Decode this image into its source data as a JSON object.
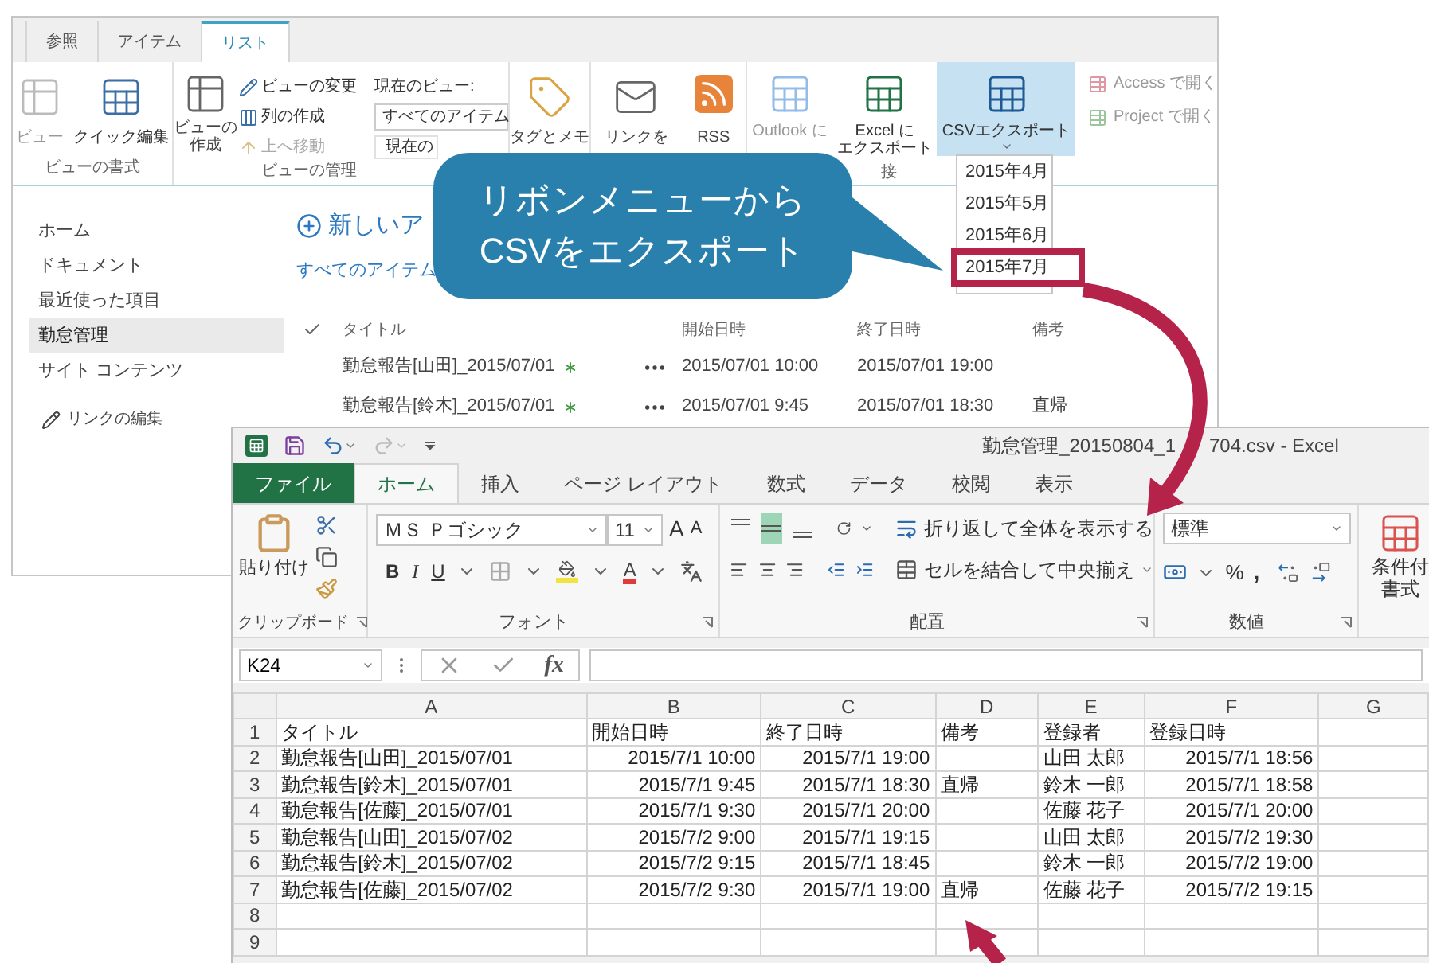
{
  "sharepoint": {
    "tabs": [
      {
        "label": "参照",
        "selected": false
      },
      {
        "label": "アイテム",
        "selected": false
      },
      {
        "label": "リスト",
        "selected": true
      }
    ],
    "ribbon": {
      "view_format": {
        "label": "ビューの書式",
        "buttons": [
          {
            "kind": "view",
            "label": "ビュー",
            "disabled": true
          },
          {
            "kind": "quick_edit",
            "label": "クイック編集",
            "disabled": false
          }
        ]
      },
      "view_manage": {
        "label": "ビューの管理",
        "create_view": [
          "ビューの",
          "作成"
        ],
        "commands": [
          {
            "kind": "modify",
            "label": "ビューの変更",
            "disabled": false
          },
          {
            "kind": "column",
            "label": "列の作成",
            "disabled": false
          },
          {
            "kind": "up",
            "label": "上へ移動",
            "disabled": true
          }
        ],
        "current_view_label": "現在のビュー:",
        "current_view": "すべてのアイテム",
        "view_nav": "現在の"
      },
      "tags": "タグとメモ",
      "share": [
        "リンクを",
        "RSS"
      ],
      "connect": {
        "label": "接",
        "buttons": [
          {
            "kind": "outlook",
            "label": [
              "Outlook に"
            ],
            "disabled": true,
            "selected": false
          },
          {
            "kind": "excel",
            "label": [
              "Excel に",
              "エクスポート"
            ],
            "disabled": false,
            "selected": false
          },
          {
            "kind": "csv",
            "label": [
              "CSVエクスポート"
            ],
            "disabled": false,
            "selected": true
          }
        ],
        "open_with": [
          {
            "kind": "access",
            "label": "Access で開く",
            "disabled": true
          },
          {
            "kind": "project",
            "label": "Project で開く",
            "disabled": true
          }
        ]
      }
    },
    "csv_menu": [
      {
        "label": "2015年4月",
        "framed": false
      },
      {
        "label": "2015年5月",
        "framed": false
      },
      {
        "label": "2015年6月",
        "framed": false
      },
      {
        "label": "2015年7月",
        "framed": true
      }
    ],
    "nav": [
      {
        "label": "ホーム",
        "selected": false
      },
      {
        "label": "ドキュメント",
        "selected": false
      },
      {
        "label": "最近使った項目",
        "selected": false
      },
      {
        "label": "勤怠管理",
        "selected": true
      },
      {
        "label": "サイト コンテンツ",
        "selected": false
      }
    ],
    "edit_links": "リンクの編集",
    "new_item": "新しいア",
    "view_link": "すべてのアイテム",
    "list": {
      "columns": [
        "タイトル",
        "開始日時",
        "終了日時",
        "備考"
      ],
      "rows": [
        {
          "title": "勤怠報告[山田]_2015/07/01",
          "new": true,
          "start": "2015/07/01 10:00",
          "end": "2015/07/01 19:00"
        },
        {
          "title": "勤怠報告[鈴木]_2015/07/01",
          "new": true,
          "start": "2015/07/01 9:45",
          "end": "2015/07/01 18:30",
          "note": "直帰"
        }
      ]
    }
  },
  "callout": "リボンメニューから\nCSVをエクスポート",
  "excel": {
    "title_start": "勤怠管理_20150804_1",
    "title_end": "704.csv - Excel",
    "tabs": [
      {
        "label": "ファイル",
        "kind": "file",
        "selected": false
      },
      {
        "label": "ホーム",
        "kind": "tab",
        "selected": true
      },
      {
        "label": "挿入",
        "kind": "tab",
        "selected": false
      },
      {
        "label": "ページ レイアウト",
        "kind": "tab",
        "selected": false
      },
      {
        "label": "数式",
        "kind": "tab",
        "selected": false
      },
      {
        "label": "データ",
        "kind": "tab",
        "selected": false
      },
      {
        "label": "校閲",
        "kind": "tab",
        "selected": false
      },
      {
        "label": "表示",
        "kind": "tab",
        "selected": false
      }
    ],
    "ribbon": {
      "clipboard": {
        "label": "クリップボード",
        "paste": "貼り付け"
      },
      "font": {
        "label": "フォント",
        "name": "ＭＳ Ｐゴシック",
        "size": "11",
        "grow": "A",
        "shrink": "A",
        "bold": "B",
        "italic": "I",
        "underline": "U",
        "color_letter": "A"
      },
      "alignment": {
        "label": "配置",
        "vertical": [
          {
            "kind": "top",
            "selected": false
          },
          {
            "kind": "middle",
            "selected": true
          },
          {
            "kind": "bottom",
            "selected": false
          }
        ],
        "wrap": "折り返して全体を表示する",
        "merge": "セルを結合して中央揃え"
      },
      "number": {
        "label": "数値",
        "format": "標準",
        "percent": "%",
        "comma": ","
      },
      "styles": {
        "conditional": [
          "条件付",
          "書式"
        ]
      }
    },
    "name_box": "K24",
    "fx": "fx",
    "columns": [
      "A",
      "B",
      "C",
      "D",
      "E",
      "F",
      "G"
    ],
    "rows": [
      {
        "number": "1",
        "cells": [
          "タイトル",
          "開始日時",
          "終了日時",
          "備考",
          "登録者",
          "登録日時"
        ]
      },
      {
        "number": "2",
        "cells": [
          "勤怠報告[山田]_2015/07/01",
          "2015/7/1 10:00",
          "2015/7/1 19:00",
          null,
          "山田 太郎",
          "2015/7/1 18:56"
        ]
      },
      {
        "number": "3",
        "cells": [
          "勤怠報告[鈴木]_2015/07/01",
          "2015/7/1 9:45",
          "2015/7/1 18:30",
          "直帰",
          "鈴木 一郎",
          "2015/7/1 18:58"
        ]
      },
      {
        "number": "4",
        "cells": [
          "勤怠報告[佐藤]_2015/07/01",
          "2015/7/1 9:30",
          "2015/7/1 20:00",
          null,
          "佐藤 花子",
          "2015/7/1 20:00"
        ]
      },
      {
        "number": "5",
        "cells": [
          "勤怠報告[山田]_2015/07/02",
          "2015/7/2 9:00",
          "2015/7/1 19:15",
          null,
          "山田 太郎",
          "2015/7/2 19:30"
        ]
      },
      {
        "number": "6",
        "cells": [
          "勤怠報告[鈴木]_2015/07/02",
          "2015/7/2 9:15",
          "2015/7/1 18:45",
          null,
          "鈴木 一郎",
          "2015/7/2 19:00"
        ]
      },
      {
        "number": "7",
        "cells": [
          "勤怠報告[佐藤]_2015/07/02",
          "2015/7/2 9:30",
          "2015/7/1 19:00",
          "直帰",
          "佐藤 花子",
          "2015/7/2 19:15"
        ]
      },
      {
        "number": "8"
      },
      {
        "number": "9"
      }
    ]
  }
}
